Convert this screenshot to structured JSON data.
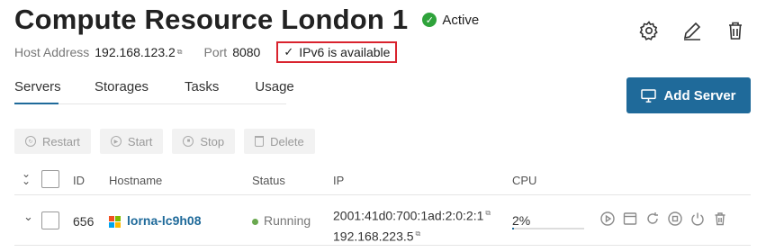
{
  "header": {
    "title": "Compute Resource London 1",
    "status": "Active",
    "host_address_label": "Host Address",
    "host_address_value": "192.168.123.2",
    "port_label": "Port",
    "port_value": "8080",
    "ipv6_text": "IPv6 is available"
  },
  "tabs": [
    {
      "label": "Servers",
      "active": true
    },
    {
      "label": "Storages",
      "active": false
    },
    {
      "label": "Tasks",
      "active": false
    },
    {
      "label": "Usage",
      "active": false
    }
  ],
  "add_server_label": "Add Server",
  "toolbar": {
    "restart": "Restart",
    "start": "Start",
    "stop": "Stop",
    "delete": "Delete"
  },
  "table": {
    "columns": [
      "ID",
      "Hostname",
      "Status",
      "IP",
      "CPU"
    ],
    "rows": [
      {
        "id": "656",
        "hostname": "lorna-lc9h08",
        "status": "Running",
        "ip_primary": "2001:41d0:700:1ad:2:0:2:1",
        "ip_secondary": "192.168.223.5",
        "cpu": "2%",
        "cpu_fraction": 0.02
      }
    ]
  },
  "colors": {
    "accent": "#1f6a9a",
    "active_green": "#2fa33b",
    "highlight_red": "#d9232e"
  }
}
